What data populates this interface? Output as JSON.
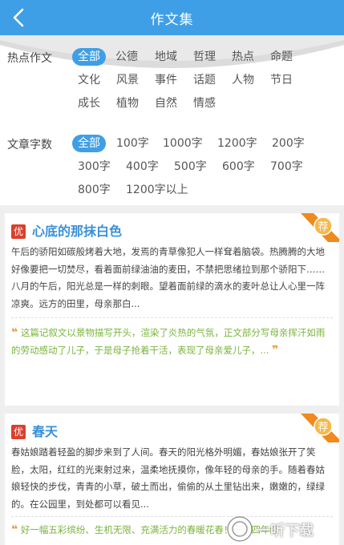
{
  "header": {
    "title": "作文集"
  },
  "filters": {
    "topic_label": "热点作文",
    "topics": [
      "全部",
      "公德",
      "地域",
      "哲理",
      "热点",
      "命题",
      "文化",
      "风景",
      "事件",
      "话题",
      "人物",
      "节日",
      "成长",
      "植物",
      "自然",
      "情感"
    ],
    "wordcount_label": "文章字数",
    "wordcounts": [
      "全部",
      "100字",
      "1000字",
      "1200字",
      "200字",
      "300字",
      "400字",
      "500字",
      "600字",
      "700字",
      "800字",
      "1200字以上"
    ]
  },
  "articles": [
    {
      "badge": "优",
      "ribbon": "荐",
      "title": "心底的那抹白色",
      "excerpt": "午后的骄阳如碳般烤着大地，发焉的青草像犯人一样耷着脑袋。热腾腾的大地好像要把一切焚尽，看着面前绿油油的麦田，不禁把思绪拉到那个骄阳下……八月的午后，阳光总是一样的刺眼。望着面前绿的滴水的麦叶总让人心里一阵凉爽。远方的田里，母亲那白...",
      "comment": "这篇记叙文以景物描写开头，渲染了炎热的气氛，正文部分写母亲挥汗如雨的劳动感动了儿子，于是母子抢着干活，表现了母亲爱儿子，..."
    },
    {
      "badge": "优",
      "ribbon": "荐",
      "title": "春天",
      "excerpt": "春姑娘踏着轻盈的脚步来到了人间。春天的阳光格外明媚，春姑娘张开了笑脸，太阳，红红的光束射过来，温柔地抚摸你，像年轻的母亲的手。随着春姑娘轻快的步伐，青青的小草，破土而出，偷偷的从土里钻出来，嫩嫩的，绿绿的。在公园里，到处都可以看见...",
      "comment": "好一幅五彩缤纷、生机无限、充满活力的春暖花春！一个四年级"
    }
  ],
  "watermark": {
    "text": "一听下载"
  },
  "colors": {
    "primary": "#3f9fe6",
    "badge": "#d9412e",
    "ribbon": "#f08a1c",
    "comment": "#7ab43c"
  }
}
